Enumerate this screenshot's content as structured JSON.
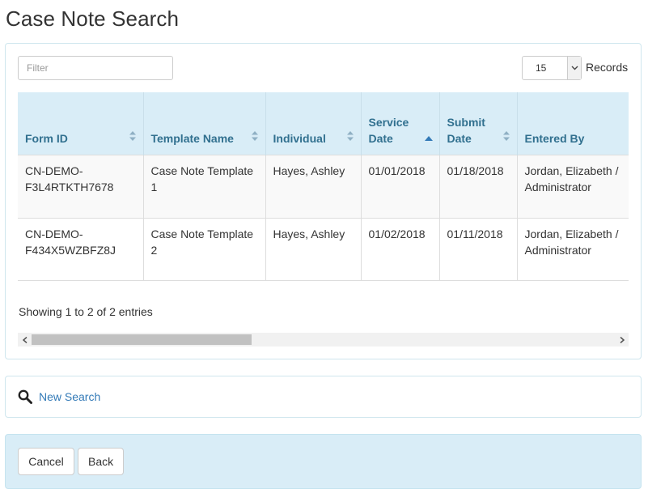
{
  "page": {
    "title": "Case Note Search"
  },
  "controls": {
    "filter_placeholder": "Filter",
    "records_value": "15",
    "records_label": "Records"
  },
  "table": {
    "columns": [
      {
        "label": "Form ID",
        "sort": "both"
      },
      {
        "label": "Template Name",
        "sort": "both"
      },
      {
        "label": "Individual",
        "sort": "both"
      },
      {
        "label": "Service Date",
        "sort": "asc"
      },
      {
        "label": "Submit Date",
        "sort": "both"
      },
      {
        "label": "Entered By",
        "sort": "both"
      }
    ],
    "rows": [
      [
        "CN-DEMO-F3L4RTKTH7678",
        "Case Note Template 1",
        "Hayes, Ashley",
        "01/01/2018",
        "01/18/2018",
        "Jordan, Elizabeth / Administrator"
      ],
      [
        "CN-DEMO-F434X5WZBFZ8J",
        "Case Note Template 2",
        "Hayes, Ashley",
        "01/02/2018",
        "01/11/2018",
        "Jordan, Elizabeth / Administrator"
      ]
    ],
    "info": "Showing 1 to 2 of 2 entries"
  },
  "search": {
    "link_label": "New Search",
    "icon": "search-icon"
  },
  "footer": {
    "cancel_label": "Cancel",
    "back_label": "Back"
  },
  "colors": {
    "header_bg": "#d9edf7",
    "header_text": "#31708f",
    "link": "#337ab7",
    "sort_active": "#337ab7"
  }
}
